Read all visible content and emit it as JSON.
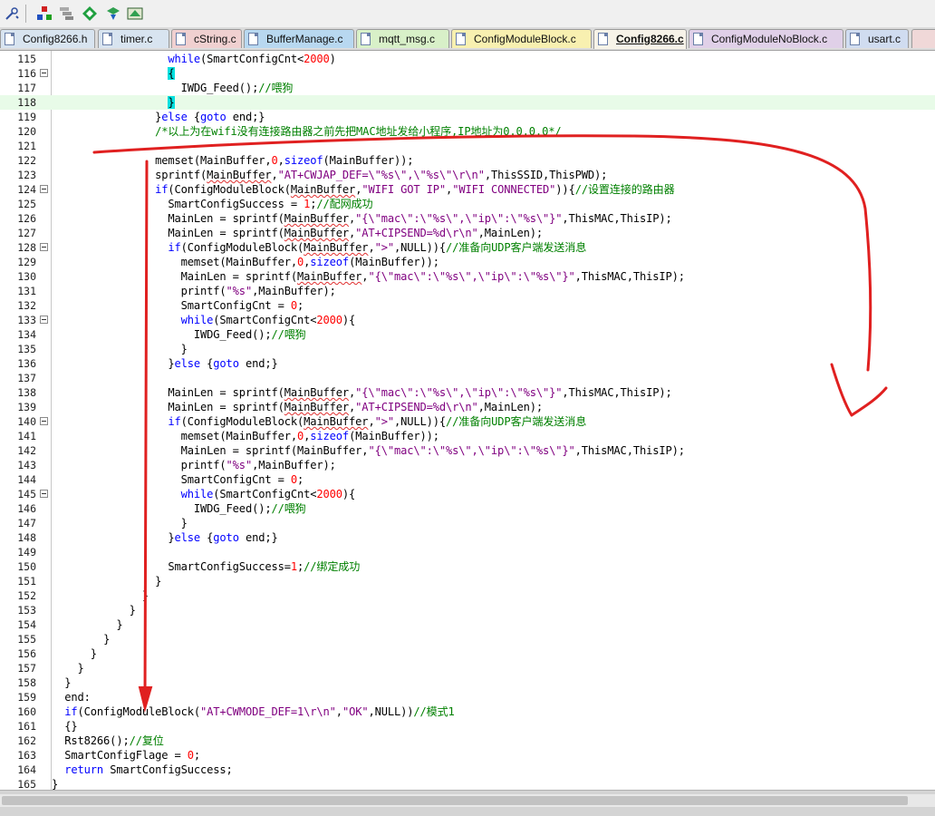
{
  "toolbar": {
    "icons": [
      "tool-icon",
      "build-icon",
      "layers-icon",
      "diamond-icon",
      "debug-icon",
      "chip-icon"
    ]
  },
  "tabs": [
    {
      "label": "Config8266.h",
      "color": "#d8e4f0",
      "active": false
    },
    {
      "label": "timer.c",
      "color": "#d8e4f0",
      "active": false
    },
    {
      "label": "cString.c",
      "color": "#f0d0d0",
      "active": false
    },
    {
      "label": "BufferManage.c",
      "color": "#b8d8f0",
      "active": false
    },
    {
      "label": "mqtt_msg.c",
      "color": "#d8f0c8",
      "active": false
    },
    {
      "label": "ConfigModuleBlock.c",
      "color": "#f8f0b0",
      "active": false
    },
    {
      "label": "Config8266.c",
      "color": "#f7f3e8",
      "active": true
    },
    {
      "label": "ConfigModuleNoBlock.c",
      "color": "#e0d0e8",
      "active": false
    },
    {
      "label": "usart.c",
      "color": "#d0dcf0",
      "active": false
    }
  ],
  "highlighted_line": 118,
  "lines": [
    {
      "n": "115",
      "fold": false,
      "t": [
        [
          "sp",
          "                  "
        ],
        [
          "kw",
          "while"
        ],
        [
          "p",
          "(SmartConfigCnt<"
        ],
        [
          "num",
          "2000"
        ],
        [
          "p",
          ")"
        ]
      ]
    },
    {
      "n": "116",
      "fold": true,
      "t": [
        [
          "sp",
          "                  "
        ],
        [
          "br",
          "{"
        ]
      ]
    },
    {
      "n": "117",
      "fold": false,
      "t": [
        [
          "sp",
          "                    "
        ],
        [
          "p",
          "IWDG_Feed();"
        ],
        [
          "cmt",
          "//喂狗"
        ]
      ]
    },
    {
      "n": "118",
      "fold": false,
      "t": [
        [
          "sp",
          "                  "
        ],
        [
          "br",
          "}"
        ]
      ]
    },
    {
      "n": "119",
      "fold": false,
      "t": [
        [
          "sp",
          "                "
        ],
        [
          "p",
          "}"
        ],
        [
          "kw",
          "else"
        ],
        [
          "p",
          " {"
        ],
        [
          "kw",
          "goto"
        ],
        [
          "p",
          " end;}"
        ]
      ]
    },
    {
      "n": "120",
      "fold": false,
      "t": [
        [
          "sp",
          "                "
        ],
        [
          "cmt",
          "/*以上为在wifi没有连接路由器之前先把MAC地址发给小程序,IP地址为0.0.0.0*/"
        ]
      ]
    },
    {
      "n": "121",
      "fold": false,
      "t": []
    },
    {
      "n": "122",
      "fold": false,
      "t": [
        [
          "sp",
          "                "
        ],
        [
          "p",
          "memset(MainBuffer,"
        ],
        [
          "num",
          "0"
        ],
        [
          "p",
          ","
        ],
        [
          "kw",
          "sizeof"
        ],
        [
          "p",
          "(MainBuffer));"
        ]
      ]
    },
    {
      "n": "123",
      "fold": false,
      "t": [
        [
          "sp",
          "                "
        ],
        [
          "p",
          "sprintf("
        ],
        [
          "ul",
          "MainBuffer"
        ],
        [
          "p",
          ","
        ],
        [
          "str",
          "\"AT+CWJAP_DEF=\\\"%s\\\",\\\"%s\\\"\\r\\n\""
        ],
        [
          "p",
          ",ThisSSID,ThisPWD);"
        ]
      ]
    },
    {
      "n": "124",
      "fold": true,
      "t": [
        [
          "sp",
          "                "
        ],
        [
          "kw",
          "if"
        ],
        [
          "p",
          "(ConfigModuleBlock("
        ],
        [
          "ul",
          "MainBuffer"
        ],
        [
          "p",
          ","
        ],
        [
          "str",
          "\"WIFI GOT IP\""
        ],
        [
          "p",
          ","
        ],
        [
          "str",
          "\"WIFI CONNECTED\""
        ],
        [
          "p",
          "))"
        ],
        [
          "p",
          "{"
        ],
        [
          "cmt",
          "//设置连接的路由器"
        ]
      ]
    },
    {
      "n": "125",
      "fold": false,
      "t": [
        [
          "sp",
          "                  "
        ],
        [
          "p",
          "SmartConfigSuccess = "
        ],
        [
          "num",
          "1"
        ],
        [
          "p",
          ";"
        ],
        [
          "cmt",
          "//配网成功"
        ]
      ]
    },
    {
      "n": "126",
      "fold": false,
      "t": [
        [
          "sp",
          "                  "
        ],
        [
          "p",
          "MainLen = sprintf("
        ],
        [
          "ul",
          "MainBuffer"
        ],
        [
          "p",
          ","
        ],
        [
          "str",
          "\"{\\\"mac\\\":\\\"%s\\\",\\\"ip\\\":\\\"%s\\\"}\""
        ],
        [
          "p",
          ",ThisMAC,ThisIP);"
        ]
      ]
    },
    {
      "n": "127",
      "fold": false,
      "t": [
        [
          "sp",
          "                  "
        ],
        [
          "p",
          "MainLen = sprintf("
        ],
        [
          "ul",
          "MainBuffer"
        ],
        [
          "p",
          ","
        ],
        [
          "str",
          "\"AT+CIPSEND=%d\\r\\n\""
        ],
        [
          "p",
          ",MainLen);"
        ]
      ]
    },
    {
      "n": "128",
      "fold": true,
      "t": [
        [
          "sp",
          "                  "
        ],
        [
          "kw",
          "if"
        ],
        [
          "p",
          "(ConfigModuleBlock("
        ],
        [
          "ul",
          "MainBuffer"
        ],
        [
          "p",
          ","
        ],
        [
          "str",
          "\">\""
        ],
        [
          "p",
          ",NULL))"
        ],
        [
          "p",
          "{"
        ],
        [
          "cmt",
          "//准备向UDP客户端发送消息"
        ]
      ]
    },
    {
      "n": "129",
      "fold": false,
      "t": [
        [
          "sp",
          "                    "
        ],
        [
          "p",
          "memset(MainBuffer,"
        ],
        [
          "num",
          "0"
        ],
        [
          "p",
          ","
        ],
        [
          "kw",
          "sizeof"
        ],
        [
          "p",
          "(MainBuffer));"
        ]
      ]
    },
    {
      "n": "130",
      "fold": false,
      "t": [
        [
          "sp",
          "                    "
        ],
        [
          "p",
          "MainLen = sprintf("
        ],
        [
          "ul",
          "MainBuffer"
        ],
        [
          "p",
          ","
        ],
        [
          "str",
          "\"{\\\"mac\\\":\\\"%s\\\",\\\"ip\\\":\\\"%s\\\"}\""
        ],
        [
          "p",
          ",ThisMAC,ThisIP);"
        ]
      ]
    },
    {
      "n": "131",
      "fold": false,
      "t": [
        [
          "sp",
          "                    "
        ],
        [
          "p",
          "printf("
        ],
        [
          "str",
          "\"%s\""
        ],
        [
          "p",
          ",MainBuffer);"
        ]
      ]
    },
    {
      "n": "132",
      "fold": false,
      "t": [
        [
          "sp",
          "                    "
        ],
        [
          "p",
          "SmartConfigCnt = "
        ],
        [
          "num",
          "0"
        ],
        [
          "p",
          ";"
        ]
      ]
    },
    {
      "n": "133",
      "fold": true,
      "t": [
        [
          "sp",
          "                    "
        ],
        [
          "kw",
          "while"
        ],
        [
          "p",
          "(SmartConfigCnt<"
        ],
        [
          "num",
          "2000"
        ],
        [
          "p",
          "){"
        ]
      ]
    },
    {
      "n": "134",
      "fold": false,
      "t": [
        [
          "sp",
          "                      "
        ],
        [
          "p",
          "IWDG_Feed();"
        ],
        [
          "cmt",
          "//喂狗"
        ]
      ]
    },
    {
      "n": "135",
      "fold": false,
      "t": [
        [
          "sp",
          "                    "
        ],
        [
          "p",
          "}"
        ]
      ]
    },
    {
      "n": "136",
      "fold": false,
      "t": [
        [
          "sp",
          "                  "
        ],
        [
          "p",
          "}"
        ],
        [
          "kw",
          "else"
        ],
        [
          "p",
          " {"
        ],
        [
          "kw",
          "goto"
        ],
        [
          "p",
          " end;}"
        ]
      ]
    },
    {
      "n": "137",
      "fold": false,
      "t": []
    },
    {
      "n": "138",
      "fold": false,
      "t": [
        [
          "sp",
          "                  "
        ],
        [
          "p",
          "MainLen = sprintf("
        ],
        [
          "ul",
          "MainBuffer"
        ],
        [
          "p",
          ","
        ],
        [
          "str",
          "\"{\\\"mac\\\":\\\"%s\\\",\\\"ip\\\":\\\"%s\\\"}\""
        ],
        [
          "p",
          ",ThisMAC,ThisIP);"
        ]
      ]
    },
    {
      "n": "139",
      "fold": false,
      "t": [
        [
          "sp",
          "                  "
        ],
        [
          "p",
          "MainLen = sprintf("
        ],
        [
          "ul",
          "MainBuffer"
        ],
        [
          "p",
          ","
        ],
        [
          "str",
          "\"AT+CIPSEND=%d\\r\\n\""
        ],
        [
          "p",
          ",MainLen);"
        ]
      ]
    },
    {
      "n": "140",
      "fold": true,
      "t": [
        [
          "sp",
          "                  "
        ],
        [
          "kw",
          "if"
        ],
        [
          "p",
          "(ConfigModuleBlock("
        ],
        [
          "ul",
          "MainBuffer"
        ],
        [
          "p",
          ","
        ],
        [
          "str",
          "\">\""
        ],
        [
          "p",
          ",NULL))"
        ],
        [
          "p",
          "{"
        ],
        [
          "cmt",
          "//准备向UDP客户端发送消息"
        ]
      ]
    },
    {
      "n": "141",
      "fold": false,
      "t": [
        [
          "sp",
          "                    "
        ],
        [
          "p",
          "memset(MainBuffer,"
        ],
        [
          "num",
          "0"
        ],
        [
          "p",
          ","
        ],
        [
          "kw",
          "sizeof"
        ],
        [
          "p",
          "(MainBuffer));"
        ]
      ]
    },
    {
      "n": "142",
      "fold": false,
      "t": [
        [
          "sp",
          "                    "
        ],
        [
          "p",
          "MainLen = sprintf(MainBuffer,"
        ],
        [
          "str",
          "\"{\\\"mac\\\":\\\"%s\\\",\\\"ip\\\":\\\"%s\\\"}\""
        ],
        [
          "p",
          ",ThisMAC,ThisIP);"
        ]
      ]
    },
    {
      "n": "143",
      "fold": false,
      "t": [
        [
          "sp",
          "                    "
        ],
        [
          "p",
          "printf("
        ],
        [
          "str",
          "\"%s\""
        ],
        [
          "p",
          ",MainBuffer);"
        ]
      ]
    },
    {
      "n": "144",
      "fold": false,
      "t": [
        [
          "sp",
          "                    "
        ],
        [
          "p",
          "SmartConfigCnt = "
        ],
        [
          "num",
          "0"
        ],
        [
          "p",
          ";"
        ]
      ]
    },
    {
      "n": "145",
      "fold": true,
      "t": [
        [
          "sp",
          "                    "
        ],
        [
          "kw",
          "while"
        ],
        [
          "p",
          "(SmartConfigCnt<"
        ],
        [
          "num",
          "2000"
        ],
        [
          "p",
          "){"
        ]
      ]
    },
    {
      "n": "146",
      "fold": false,
      "t": [
        [
          "sp",
          "                      "
        ],
        [
          "p",
          "IWDG_Feed();"
        ],
        [
          "cmt",
          "//喂狗"
        ]
      ]
    },
    {
      "n": "147",
      "fold": false,
      "t": [
        [
          "sp",
          "                    "
        ],
        [
          "p",
          "}"
        ]
      ]
    },
    {
      "n": "148",
      "fold": false,
      "t": [
        [
          "sp",
          "                  "
        ],
        [
          "p",
          "}"
        ],
        [
          "kw",
          "else"
        ],
        [
          "p",
          " {"
        ],
        [
          "kw",
          "goto"
        ],
        [
          "p",
          " end;}"
        ]
      ]
    },
    {
      "n": "149",
      "fold": false,
      "t": []
    },
    {
      "n": "150",
      "fold": false,
      "t": [
        [
          "sp",
          "                  "
        ],
        [
          "p",
          "SmartConfigSuccess="
        ],
        [
          "num",
          "1"
        ],
        [
          "p",
          ";"
        ],
        [
          "cmt",
          "//绑定成功"
        ]
      ]
    },
    {
      "n": "151",
      "fold": false,
      "t": [
        [
          "sp",
          "                "
        ],
        [
          "p",
          "}"
        ]
      ]
    },
    {
      "n": "152",
      "fold": false,
      "t": [
        [
          "sp",
          "              "
        ],
        [
          "p",
          "}"
        ]
      ]
    },
    {
      "n": "153",
      "fold": false,
      "t": [
        [
          "sp",
          "            "
        ],
        [
          "p",
          "}"
        ]
      ]
    },
    {
      "n": "154",
      "fold": false,
      "t": [
        [
          "sp",
          "          "
        ],
        [
          "p",
          "}"
        ]
      ]
    },
    {
      "n": "155",
      "fold": false,
      "t": [
        [
          "sp",
          "        "
        ],
        [
          "p",
          "}"
        ]
      ]
    },
    {
      "n": "156",
      "fold": false,
      "t": [
        [
          "sp",
          "      "
        ],
        [
          "p",
          "}"
        ]
      ]
    },
    {
      "n": "157",
      "fold": false,
      "t": [
        [
          "sp",
          "    "
        ],
        [
          "p",
          "}"
        ]
      ]
    },
    {
      "n": "158",
      "fold": false,
      "t": [
        [
          "sp",
          "  "
        ],
        [
          "p",
          "}"
        ]
      ]
    },
    {
      "n": "159",
      "fold": false,
      "t": [
        [
          "sp",
          "  "
        ],
        [
          "p",
          "end:"
        ]
      ]
    },
    {
      "n": "160",
      "fold": false,
      "t": [
        [
          "sp",
          "  "
        ],
        [
          "kw",
          "if"
        ],
        [
          "p",
          "(ConfigModuleBlock("
        ],
        [
          "str",
          "\"AT+CWMODE_DEF=1\\r\\n\""
        ],
        [
          "p",
          ","
        ],
        [
          "str",
          "\"OK\""
        ],
        [
          "p",
          ",NULL))"
        ],
        [
          "cmt",
          "//模式1"
        ]
      ]
    },
    {
      "n": "161",
      "fold": false,
      "t": [
        [
          "sp",
          "  "
        ],
        [
          "p",
          "{}"
        ]
      ]
    },
    {
      "n": "162",
      "fold": false,
      "t": [
        [
          "sp",
          "  "
        ],
        [
          "p",
          "Rst8266();"
        ],
        [
          "cmt",
          "//复位"
        ]
      ]
    },
    {
      "n": "163",
      "fold": false,
      "t": [
        [
          "sp",
          "  "
        ],
        [
          "p",
          "SmartConfigFlage = "
        ],
        [
          "num",
          "0"
        ],
        [
          "p",
          ";"
        ]
      ]
    },
    {
      "n": "164",
      "fold": false,
      "t": [
        [
          "sp",
          "  "
        ],
        [
          "kw",
          "return"
        ],
        [
          "p",
          " SmartConfigSuccess;"
        ]
      ]
    },
    {
      "n": "165",
      "fold": false,
      "t": [
        [
          "p",
          "}"
        ]
      ]
    }
  ],
  "annotation_color": "#e02020"
}
